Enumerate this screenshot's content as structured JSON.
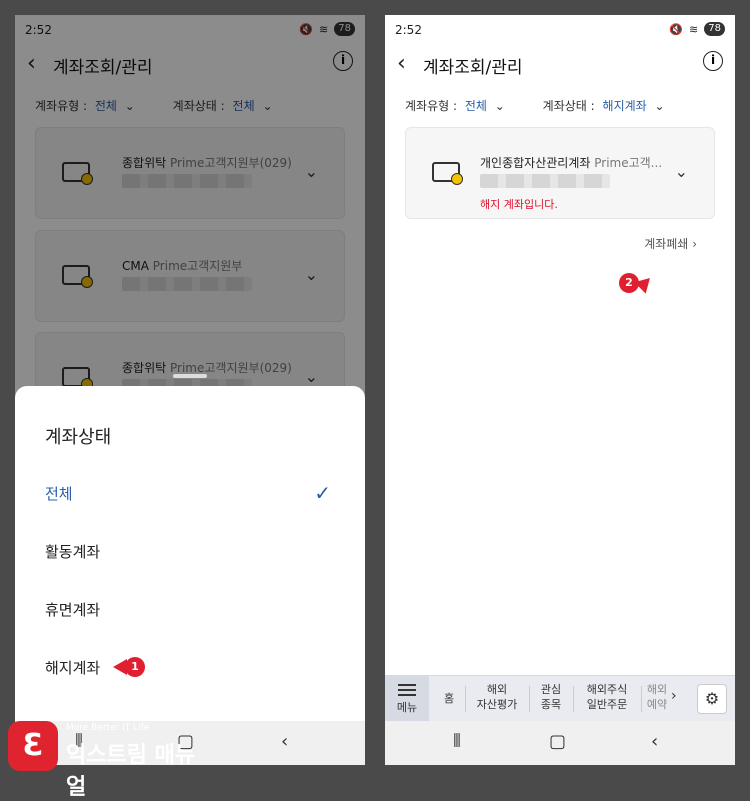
{
  "left": {
    "status": {
      "time": "2:52",
      "battery": "78"
    },
    "appbar": {
      "title": "계좌조회/관리"
    },
    "filters": {
      "type_label": "계좌유형 :",
      "type_value": "전체",
      "status_label": "계좌상태 :",
      "status_value": "전체"
    },
    "cards": [
      {
        "product": "종합위탁",
        "branch": "Prime고객지원부(029)"
      },
      {
        "product": "CMA",
        "branch": "Prime고객지원부"
      },
      {
        "product": "종합위탁",
        "branch": "Prime고객지원부(029)"
      }
    ],
    "sheet": {
      "title": "계좌상태",
      "options": [
        "전체",
        "활동계좌",
        "휴면계좌",
        "해지계좌"
      ],
      "selected_index": 0
    },
    "marker_number": "1"
  },
  "right": {
    "status": {
      "time": "2:52",
      "battery": "78"
    },
    "appbar": {
      "title": "계좌조회/관리"
    },
    "filters": {
      "type_label": "계좌유형 :",
      "type_value": "전체",
      "status_label": "계좌상태 :",
      "status_value": "해지계좌"
    },
    "card": {
      "product": "개인종합자산관리계좌",
      "branch": "Prime고객...",
      "note": "해지 계좌입니다."
    },
    "close_link": "계좌폐쇄",
    "marker_number": "2",
    "tabs": {
      "menu": "메뉴",
      "items": [
        "홈",
        "해외\n자산평가",
        "관심\n종목",
        "해외주식\n일반주문",
        "해외\n예약"
      ]
    }
  },
  "watermark": {
    "small": "More Better IT Life",
    "big": "익스트림 매뉴얼"
  },
  "colors": {
    "accent": "#2a5fa8",
    "marker": "#e02030",
    "note": "#e0102a"
  }
}
